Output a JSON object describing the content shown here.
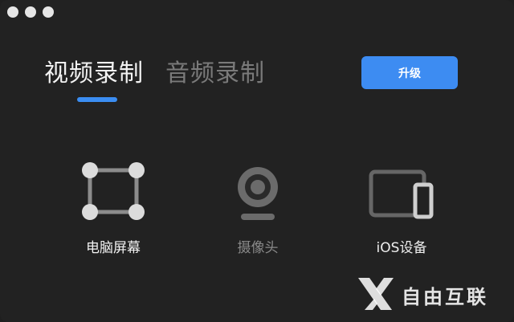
{
  "window": {
    "traffic_lights": [
      "close",
      "minimize",
      "zoom"
    ]
  },
  "tabs": [
    {
      "label": "视频录制",
      "active": true
    },
    {
      "label": "音频录制",
      "active": false
    }
  ],
  "upgrade_button": {
    "label": "升级"
  },
  "options": [
    {
      "label": "电脑屏幕",
      "icon": "screen-region-icon"
    },
    {
      "label": "摄像头",
      "icon": "webcam-icon"
    },
    {
      "label": "iOS设备",
      "icon": "ios-device-icon"
    }
  ],
  "watermark": {
    "text": "自由互联"
  },
  "colors": {
    "background": "#222222",
    "accent": "#3d8cf2",
    "active_text": "#f2f2f2",
    "inactive_text": "#7a7a7a"
  }
}
